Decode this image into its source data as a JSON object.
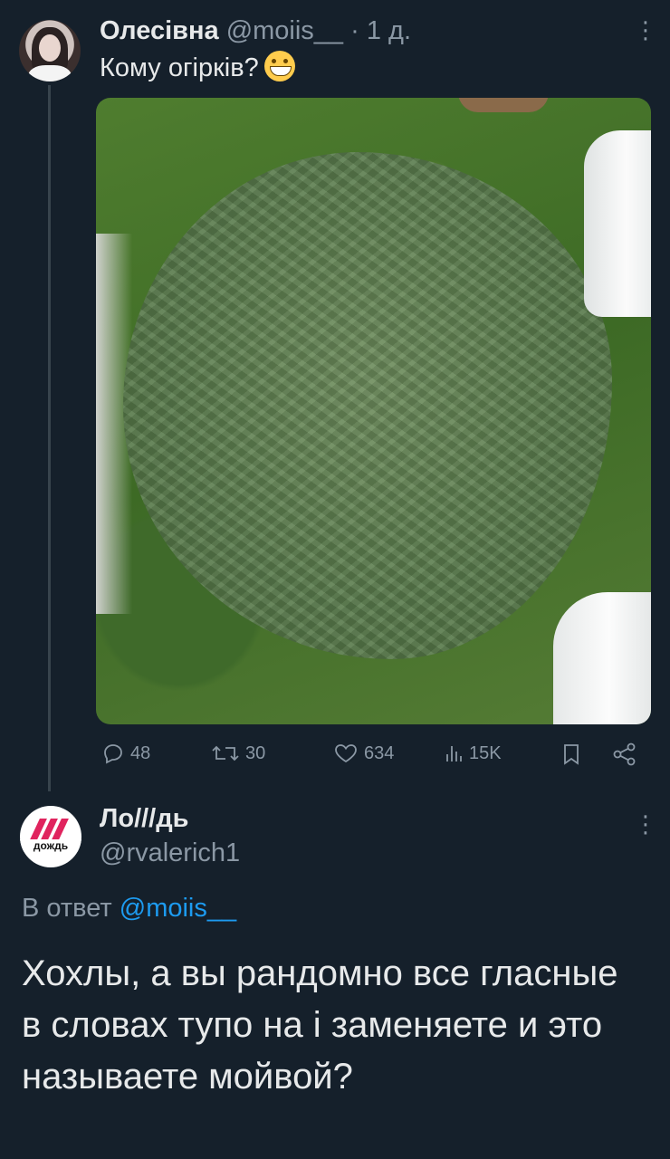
{
  "tweet1": {
    "author_name": "Олесівна",
    "author_handle": "@moiis__",
    "separator": "·",
    "time": "1 д.",
    "text": "Кому огірків?",
    "emoji_icon": "grinning-face-icon",
    "more_label": "⋮",
    "image_icon": "photo-cucumbers",
    "stats": {
      "replies": "48",
      "retweets": "30",
      "likes": "634",
      "views": "15K"
    }
  },
  "tweet2": {
    "author_name": "Ло///дь",
    "author_handle": "@rvalerich1",
    "avatar_label": "дождь",
    "more_label": "⋮",
    "reply_prefix": "В ответ",
    "reply_mention": "@moiis__",
    "text": "Хохлы, а вы рандомно все гласные в словах тупо на і заменяете и это называете мойвой?"
  },
  "colors": {
    "background": "#15202b",
    "text": "#e7e9ea",
    "muted": "#8b98a5",
    "link": "#1d9bf0"
  }
}
